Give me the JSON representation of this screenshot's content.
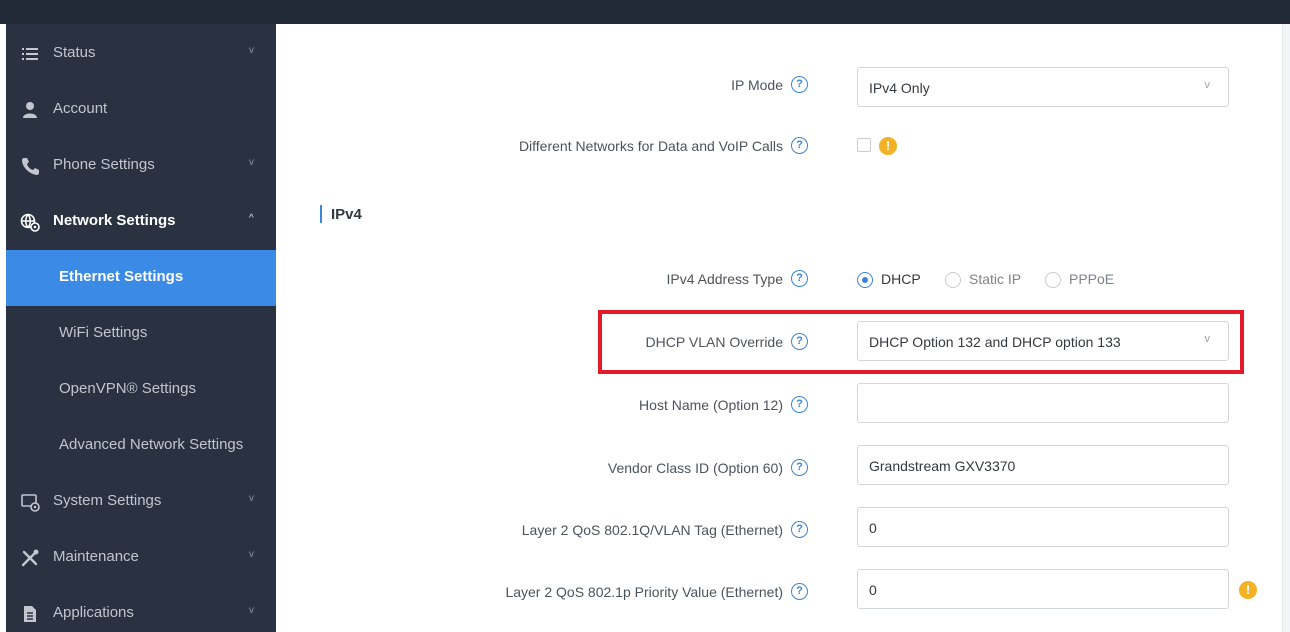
{
  "sidebar": {
    "items": [
      {
        "label": "Status",
        "icon": "list-icon",
        "chevron": "v"
      },
      {
        "label": "Account",
        "icon": "user-icon",
        "chevron": ""
      },
      {
        "label": "Phone Settings",
        "icon": "phone-icon",
        "chevron": "v"
      },
      {
        "label": "Network Settings",
        "icon": "network-gear-icon",
        "chevron": "^"
      },
      {
        "label": "System Settings",
        "icon": "system-settings-icon",
        "chevron": "v"
      },
      {
        "label": "Maintenance",
        "icon": "tools-icon",
        "chevron": "v"
      },
      {
        "label": "Applications",
        "icon": "document-icon",
        "chevron": "v"
      }
    ],
    "network_sub": [
      {
        "label": "Ethernet Settings",
        "active": true
      },
      {
        "label": "WiFi Settings",
        "active": false
      },
      {
        "label": "OpenVPN® Settings",
        "active": false
      },
      {
        "label": "Advanced Network Settings",
        "active": false
      }
    ]
  },
  "form": {
    "ip_mode": {
      "label": "IP Mode",
      "value": "IPv4 Only"
    },
    "diff_networks": {
      "label": "Different Networks for Data and VoIP Calls",
      "checked": false
    },
    "section_ipv4": "IPv4",
    "ipv4_address_type": {
      "label": "IPv4 Address Type",
      "options": [
        "DHCP",
        "Static IP",
        "PPPoE"
      ],
      "selected": "DHCP"
    },
    "dhcp_vlan_override": {
      "label": "DHCP VLAN Override",
      "value": "DHCP Option 132 and DHCP option 133"
    },
    "host_name": {
      "label": "Host Name (Option 12)",
      "value": ""
    },
    "vendor_class": {
      "label": "Vendor Class ID (Option 60)",
      "value": "Grandstream GXV3370"
    },
    "qos_vlan_tag": {
      "label": "Layer 2 QoS 802.1Q/VLAN Tag (Ethernet)",
      "value": "0"
    },
    "qos_priority": {
      "label": "Layer 2 QoS 802.1p Priority Value (Ethernet)",
      "value": "0"
    },
    "help_glyph": "?",
    "warn_glyph": "!",
    "select_arrow": "v"
  },
  "colors": {
    "accent": "#3a85d6",
    "highlight": "#e21b2a",
    "sidebar_bg": "#2a3140",
    "active_bg": "#3b8be6",
    "warning": "#f3b226"
  }
}
